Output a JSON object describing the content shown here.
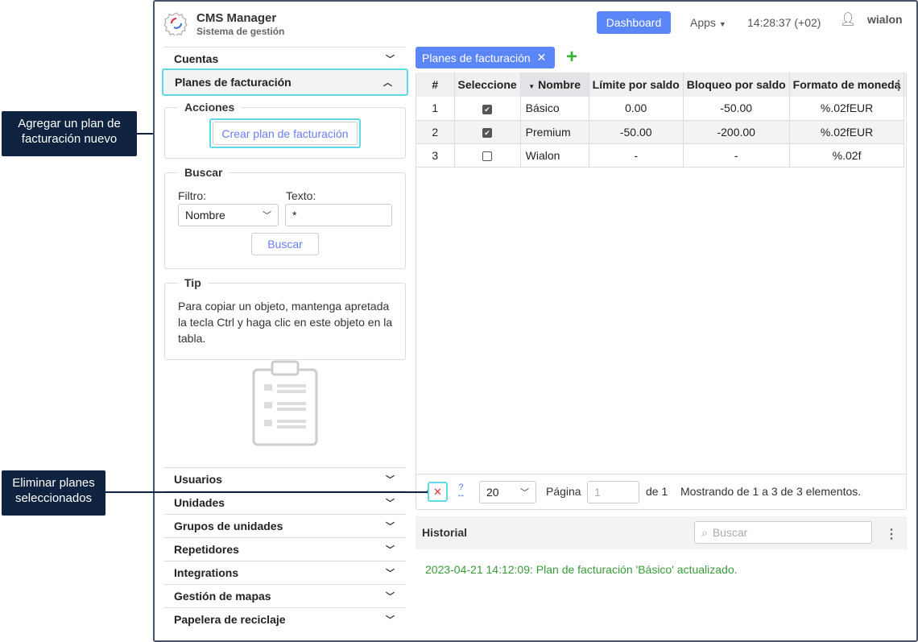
{
  "callouts": {
    "add": "Agregar un plan de facturación nuevo",
    "delete": "Eliminar planes seleccionados"
  },
  "header": {
    "app_title": "CMS Manager",
    "app_subtitle": "Sistema de gestión",
    "dashboard": "Dashboard",
    "apps": "Apps",
    "time": "14:28:37 (+02)",
    "user": "wialon"
  },
  "sidebar": {
    "cuentas": "Cuentas",
    "planes": "Planes de facturación",
    "acciones": {
      "legend": "Acciones",
      "create": "Crear plan de facturación"
    },
    "buscar": {
      "legend": "Buscar",
      "filtro_label": "Filtro:",
      "filtro_value": "Nombre",
      "texto_label": "Texto:",
      "texto_value": "*",
      "button": "Buscar"
    },
    "tip": {
      "legend": "Tip",
      "text": "Para copiar un objeto, mantenga apretada la tecla Ctrl y haga clic en este objeto en la tabla."
    },
    "items": [
      "Usuarios",
      "Unidades",
      "Grupos de unidades",
      "Repetidores",
      "Integrations",
      "Gestión de mapas",
      "Papelera de reciclaje"
    ]
  },
  "tab": {
    "label": "Planes de facturación"
  },
  "table": {
    "headers": [
      "#",
      "Seleccione",
      "Nombre",
      "Límite por saldo",
      "Bloqueo por saldo",
      "Formato de moneda"
    ],
    "rows": [
      {
        "n": "1",
        "checked": true,
        "name": "Básico",
        "limit": "0.00",
        "block": "-50.00",
        "format": "%.02fEUR"
      },
      {
        "n": "2",
        "checked": true,
        "name": "Premium",
        "limit": "-50.00",
        "block": "-200.00",
        "format": "%.02fEUR"
      },
      {
        "n": "3",
        "checked": false,
        "name": "Wialon",
        "limit": "-",
        "block": "-",
        "format": "%.02f"
      }
    ]
  },
  "pager": {
    "page_size": "20",
    "page_label": "Página",
    "page_value": "1",
    "of": "de 1",
    "showing": "Mostrando de 1 a 3 de 3 elementos."
  },
  "history": {
    "title": "Historial",
    "search_placeholder": "Buscar",
    "entry": "2023-04-21 14:12:09: Plan de facturación 'Básico' actualizado."
  },
  "colors": {
    "accent": "#5b86f7",
    "highlight": "#5fd8e8",
    "callout": "#0f2340",
    "history_text": "#3a9a3a"
  }
}
